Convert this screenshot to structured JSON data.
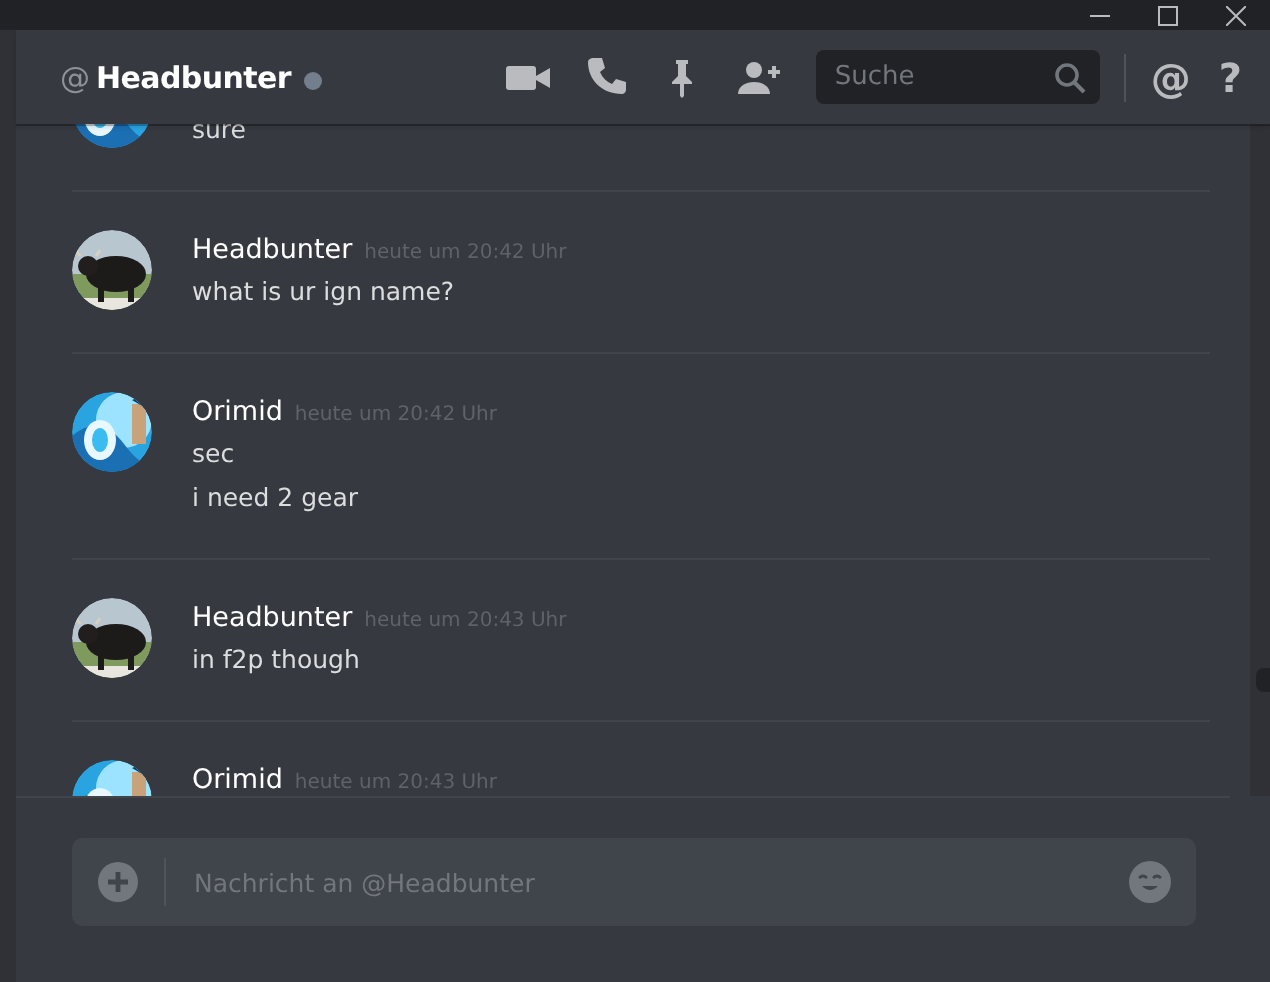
{
  "header": {
    "prefix": "@",
    "username": "Headbunter",
    "online": false,
    "search": {
      "placeholder": "Suche"
    },
    "mention": "@",
    "help": "?"
  },
  "messages": [
    {
      "lines": [
        "sure"
      ]
    },
    {
      "author": "Headbunter",
      "time": "heute um 20:42 Uhr",
      "lines": [
        "what is ur ign name?"
      ]
    },
    {
      "author": "Orimid",
      "time": "heute um 20:42 Uhr",
      "lines": [
        "sec",
        "i need 2 gear"
      ]
    },
    {
      "author": "Headbunter",
      "time": "heute um 20:43 Uhr",
      "lines": [
        "in f2p though"
      ]
    },
    {
      "author": "Orimid",
      "time": "heute um 20:43 Uhr"
    }
  ],
  "composer": {
    "placeholder": "Nachricht an @Headbunter"
  }
}
